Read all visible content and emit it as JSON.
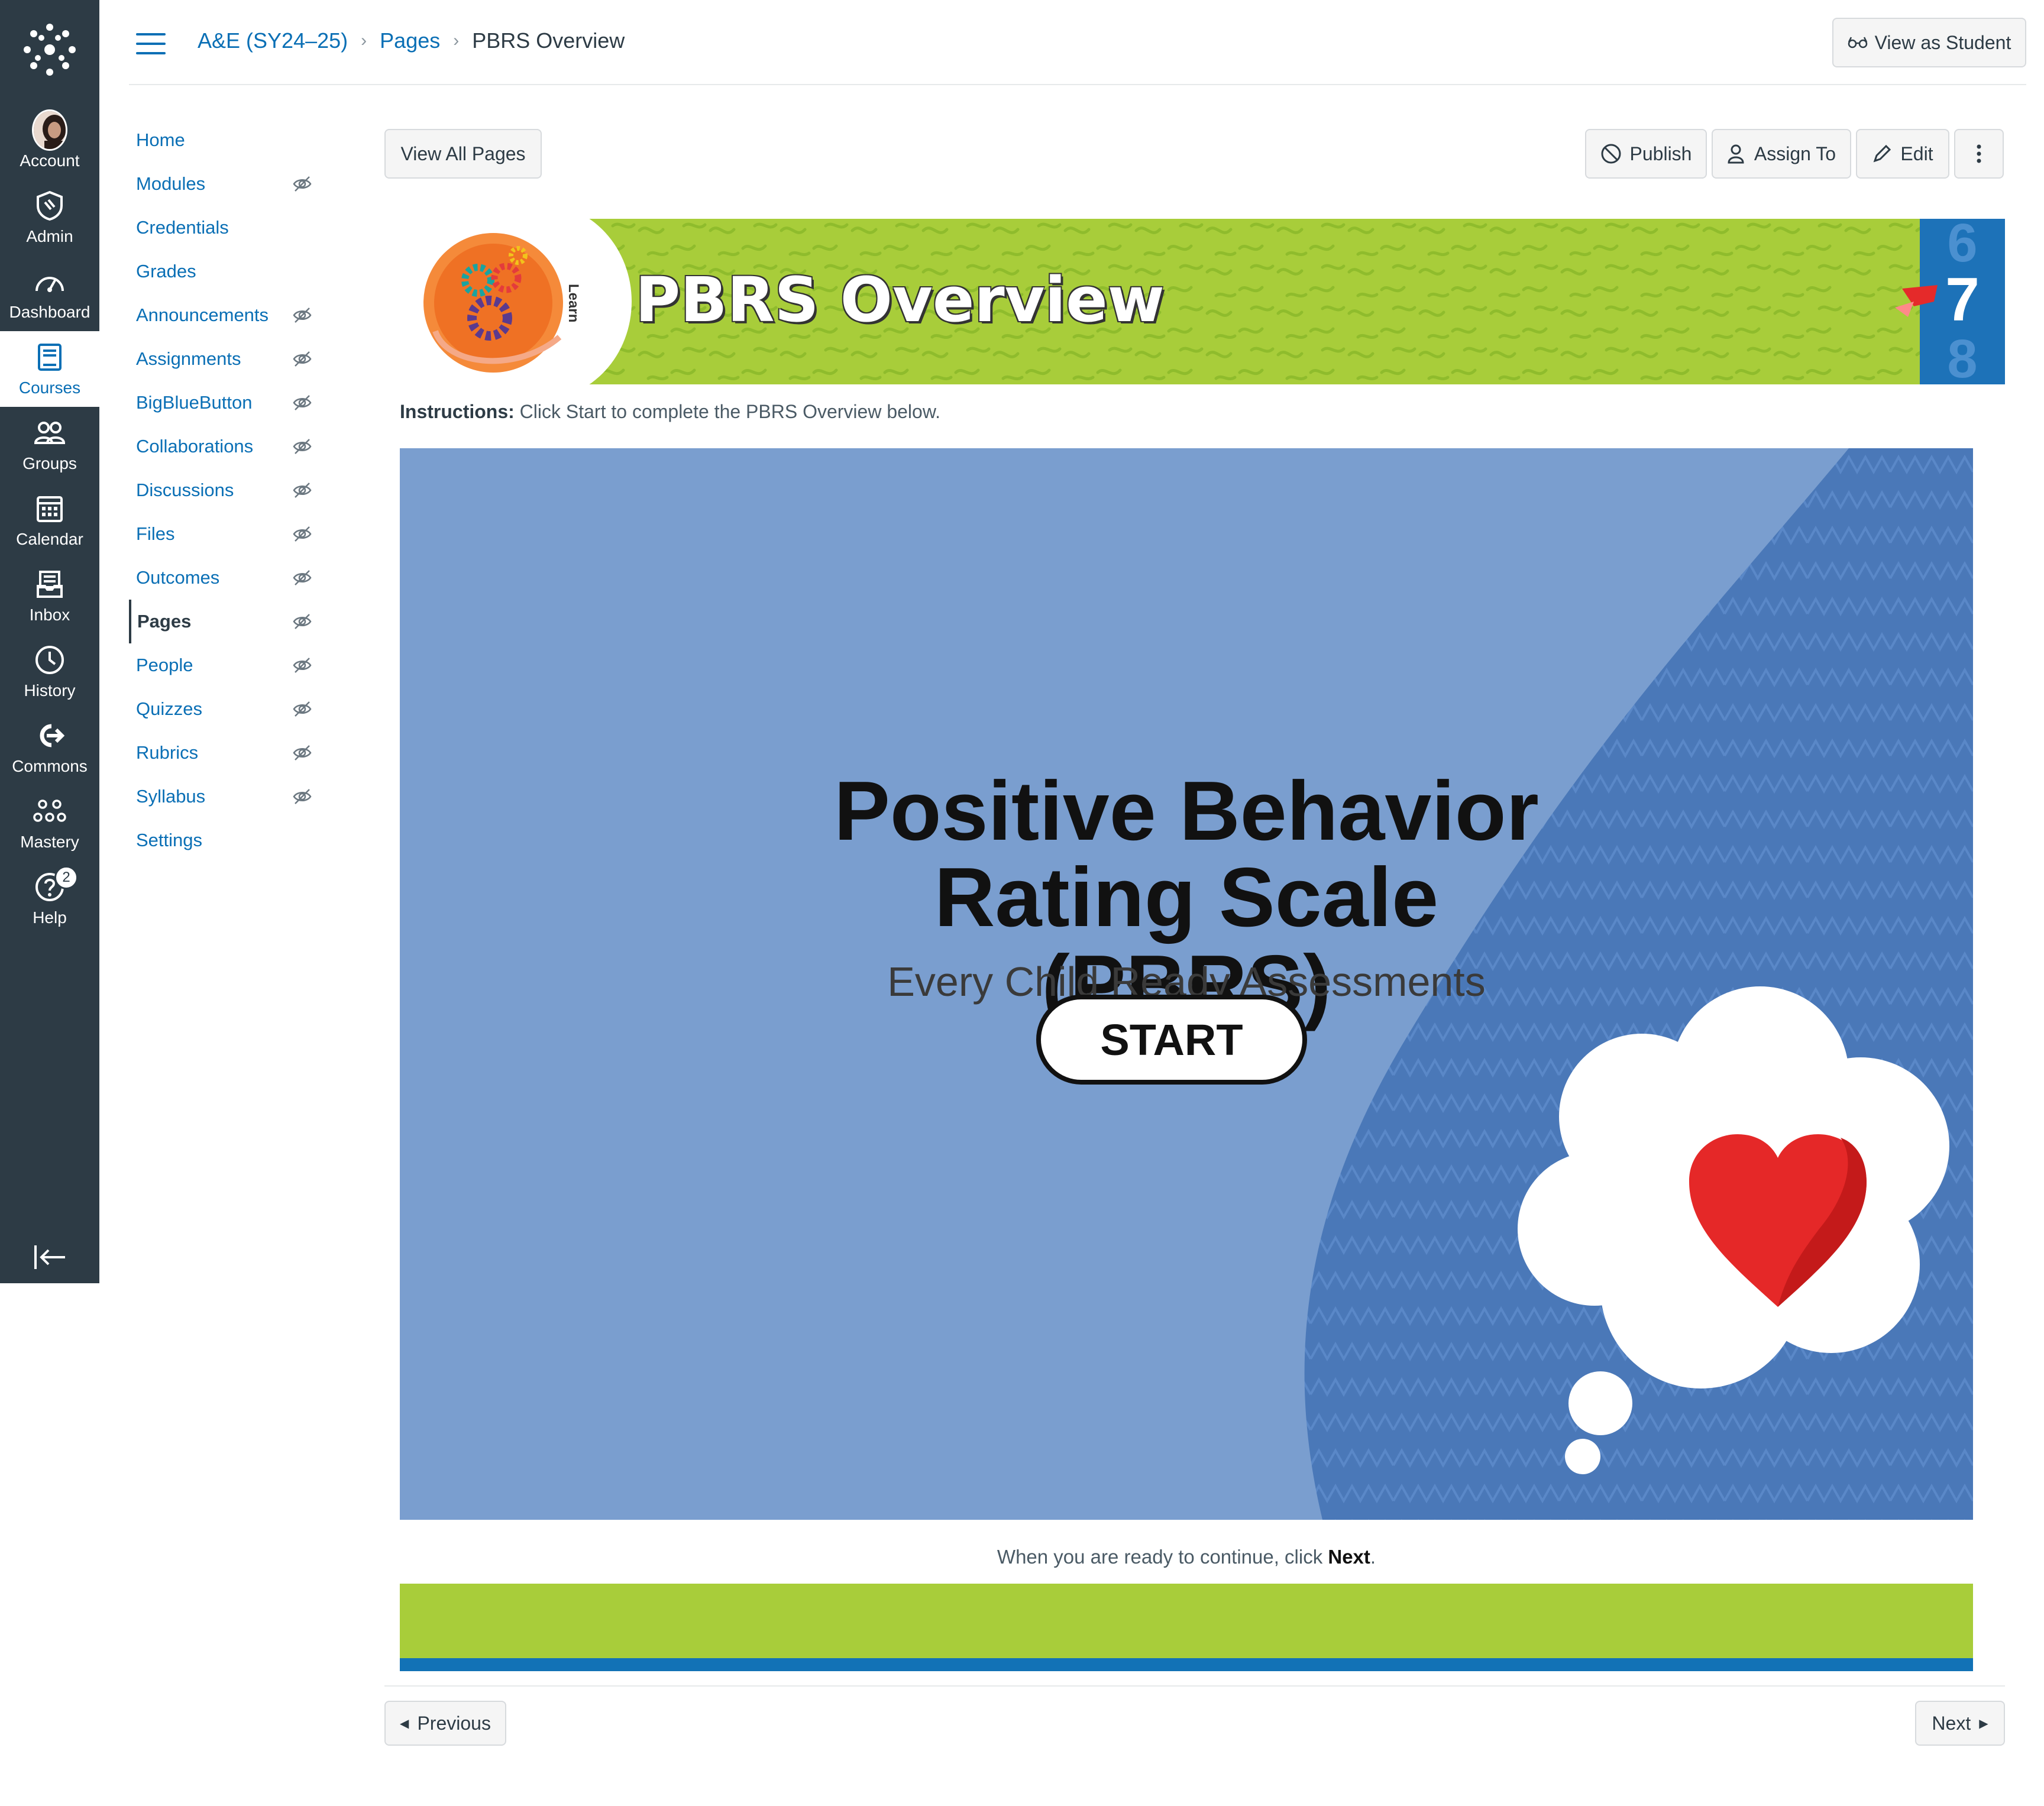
{
  "global_nav": {
    "items": [
      {
        "label": "Account",
        "icon": "avatar"
      },
      {
        "label": "Admin",
        "icon": "shield-icon"
      },
      {
        "label": "Dashboard",
        "icon": "dashboard-icon"
      },
      {
        "label": "Courses",
        "icon": "courses-icon",
        "active": true
      },
      {
        "label": "Groups",
        "icon": "groups-icon"
      },
      {
        "label": "Calendar",
        "icon": "calendar-icon"
      },
      {
        "label": "Inbox",
        "icon": "inbox-icon"
      },
      {
        "label": "History",
        "icon": "clock-icon"
      },
      {
        "label": "Commons",
        "icon": "commons-icon"
      },
      {
        "label": "Mastery",
        "icon": "mastery-icon"
      },
      {
        "label": "Help",
        "icon": "help-icon",
        "badge": "2"
      }
    ]
  },
  "header": {
    "breadcrumbs": [
      "A&E (SY24–25)",
      "Pages",
      "PBRS Overview"
    ],
    "view_as_student": "View as Student"
  },
  "course_nav": {
    "items": [
      {
        "label": "Home",
        "hidden": false
      },
      {
        "label": "Modules",
        "hidden": true
      },
      {
        "label": "Credentials",
        "hidden": false
      },
      {
        "label": "Grades",
        "hidden": false
      },
      {
        "label": "Announcements",
        "hidden": true
      },
      {
        "label": "Assignments",
        "hidden": true
      },
      {
        "label": "BigBlueButton",
        "hidden": true
      },
      {
        "label": "Collaborations",
        "hidden": true
      },
      {
        "label": "Discussions",
        "hidden": true
      },
      {
        "label": "Files",
        "hidden": true
      },
      {
        "label": "Outcomes",
        "hidden": true
      },
      {
        "label": "Pages",
        "hidden": true,
        "active": true
      },
      {
        "label": "People",
        "hidden": true
      },
      {
        "label": "Quizzes",
        "hidden": true
      },
      {
        "label": "Rubrics",
        "hidden": true
      },
      {
        "label": "Syllabus",
        "hidden": true
      },
      {
        "label": "Settings",
        "hidden": false
      }
    ]
  },
  "toolbar": {
    "view_all_pages": "View All Pages",
    "publish": "Publish",
    "assign_to": "Assign To",
    "edit": "Edit"
  },
  "banner": {
    "title": "PBRS Overview",
    "badge_text": "Learn",
    "grades": [
      "6",
      "7",
      "8"
    ]
  },
  "page": {
    "instructions_label": "Instructions:",
    "instructions_text": " Click Start to complete the PBRS Overview below.",
    "slide_title_line1": "Positive Behavior",
    "slide_title_line2": "Rating Scale (PBRS)",
    "slide_subtitle": "Every Child Ready Assessments",
    "start_label": "START",
    "continue_prefix": "When you are ready to continue, click ",
    "continue_bold": "Next",
    "continue_suffix": "."
  },
  "footer_nav": {
    "previous": "Previous",
    "next": "Next"
  },
  "colors": {
    "nav_bg": "#2d3b45",
    "link": "#0a6fb5",
    "banner_green": "#a8cd3a",
    "slide_blue": "#7a9ecf",
    "wave_blue": "#4a78b8"
  }
}
